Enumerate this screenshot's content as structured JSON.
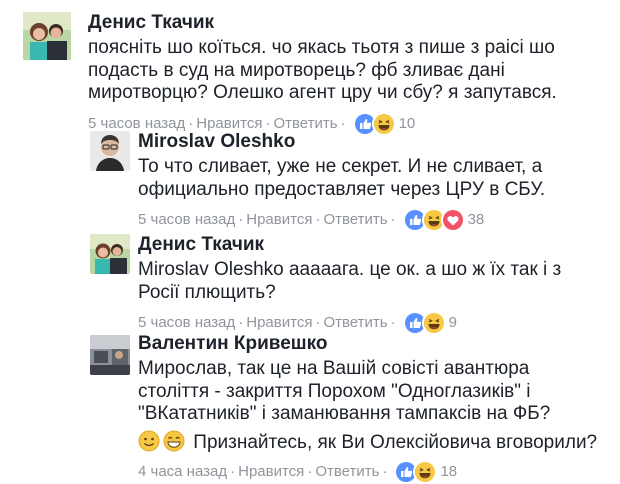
{
  "comments": [
    {
      "author": "Денис Ткачик",
      "lines": [
        "поясніть шо коїться. чо якась тьотя з пише з раісі шо",
        "подасть в суд на миротворець? фб зливає дані",
        "миротворцю? Олешко агент цру чи сбу? я запутався."
      ],
      "time": "5 часов назад",
      "like": "Нравится",
      "reply": "Ответить",
      "reactions": [
        "like-icon",
        "haha-icon"
      ],
      "count": "10"
    },
    {
      "author": "Miroslav Oleshko",
      "lines": [
        "То что сливает, уже не секрет. И не сливает, а",
        "официально предоставляет через ЦРУ в СБУ."
      ],
      "time": "5 часов назад",
      "like": "Нравится",
      "reply": "Ответить",
      "reactions": [
        "like-icon",
        "haha-icon",
        "love-icon"
      ],
      "count": "38"
    },
    {
      "author": "Денис Ткачик",
      "lines": [
        "Miroslav Oleshko ааааага. це ок. а шо ж їх так і з",
        "Росії плющить?"
      ],
      "time": "5 часов назад",
      "like": "Нравится",
      "reply": "Ответить",
      "reactions": [
        "like-icon",
        "haha-icon"
      ],
      "count": "9"
    },
    {
      "author": "Валентин Кривешко",
      "lines": [
        "Мирослав, так це на Вашій совісті авантюра",
        "століття - закриття Порохом \"Одноглазиків\" і",
        "\"ВКататників\" і заманювання тампаксів на ФБ?"
      ],
      "emoji_line": "Признайтесь, як Ви Олексійовича вговорили?",
      "emoji_icons": [
        "slight-smile-emoji",
        "grin-emoji"
      ],
      "time": "4 часа назад",
      "like": "Нравится",
      "reply": "Ответить",
      "reactions": [
        "like-icon",
        "haha-icon"
      ],
      "count": "18"
    }
  ],
  "colors": {
    "name": "#1d2129",
    "meta": "#90949c",
    "like": "#5890ff",
    "haha": "#f7c844",
    "love": "#f25268"
  }
}
